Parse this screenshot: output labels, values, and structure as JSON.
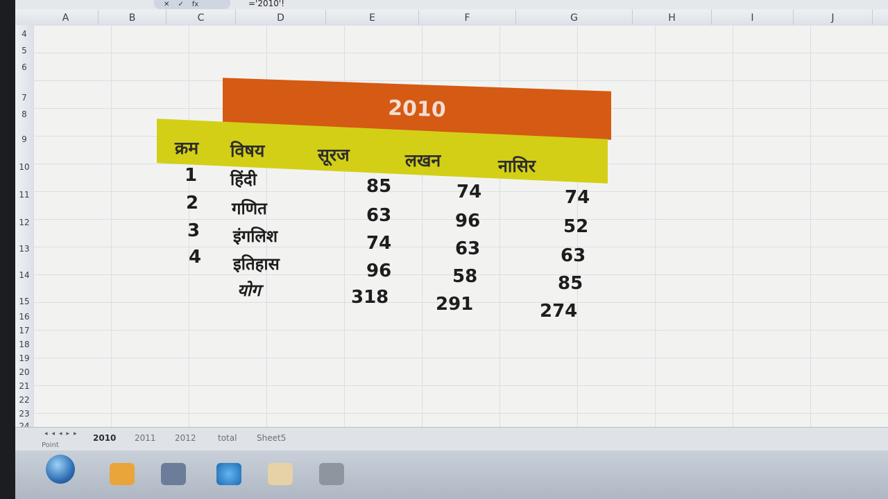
{
  "formula_bar": {
    "buttons": [
      "✕",
      "✓",
      "fx"
    ],
    "content": "='2010'!"
  },
  "columns": [
    "A",
    "B",
    "C",
    "D",
    "E",
    "F",
    "G",
    "H",
    "I",
    "J"
  ],
  "rows": [
    "4",
    "5",
    "6",
    "7",
    "8",
    "9",
    "10",
    "11",
    "12",
    "13",
    "14",
    "15",
    "16",
    "17",
    "18",
    "19",
    "20",
    "21",
    "22",
    "23",
    "24"
  ],
  "sheet": {
    "title": "2010",
    "headers": [
      "क्रम",
      "विषय",
      "सूरज",
      "लखन",
      "नासिर"
    ],
    "rows": [
      {
        "n": "1",
        "subject": "हिंदी",
        "v1": "85",
        "v2": "74",
        "v3": "74"
      },
      {
        "n": "2",
        "subject": "गणित",
        "v1": "63",
        "v2": "96",
        "v3": "52"
      },
      {
        "n": "3",
        "subject": "इंगलिश",
        "v1": "74",
        "v2": "63",
        "v3": "63"
      },
      {
        "n": "4",
        "subject": "इतिहास",
        "v1": "96",
        "v2": "58",
        "v3": "85"
      }
    ],
    "total": {
      "label": "योग",
      "v1": "318",
      "v2": "291",
      "v3": "274"
    }
  },
  "tabs": [
    "2010",
    "2011",
    "2012",
    "total",
    "Sheet5"
  ],
  "status_left": "Point",
  "colors": {
    "title_band": "#d55a13",
    "header_band": "#d3cf16"
  }
}
